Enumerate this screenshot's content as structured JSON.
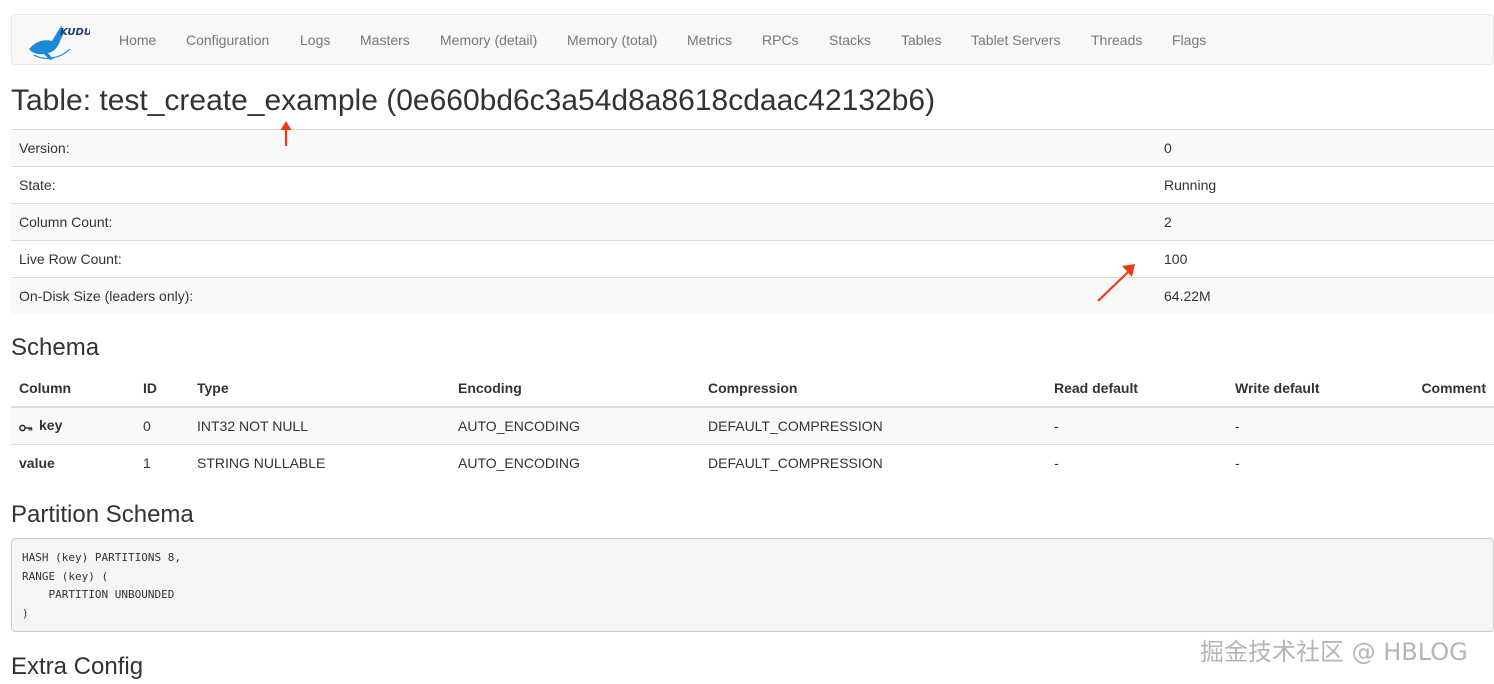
{
  "nav": {
    "brand_text": "KUDU",
    "items": [
      "Home",
      "Configuration",
      "Logs",
      "Masters",
      "Memory (detail)",
      "Memory (total)",
      "Metrics",
      "RPCs",
      "Stacks",
      "Tables",
      "Tablet Servers",
      "Threads",
      "Flags"
    ]
  },
  "page_title": "Table: test_create_example (0e660bd6c3a54d8a8618cdaac42132b6)",
  "summary": [
    {
      "label": "Version:",
      "value": "0"
    },
    {
      "label": "State:",
      "value": "Running"
    },
    {
      "label": "Column Count:",
      "value": "2"
    },
    {
      "label": "Live Row Count:",
      "value": "100"
    },
    {
      "label": "On-Disk Size (leaders only):",
      "value": "64.22M"
    }
  ],
  "schema": {
    "title": "Schema",
    "headers": [
      "Column",
      "ID",
      "Type",
      "Encoding",
      "Compression",
      "Read default",
      "Write default",
      "Comment"
    ],
    "rows": [
      {
        "column": "key",
        "id": "0",
        "type": "INT32 NOT NULL",
        "encoding": "AUTO_ENCODING",
        "compression": "DEFAULT_COMPRESSION",
        "read_default": "-",
        "write_default": "-",
        "comment": ""
      },
      {
        "column": "value",
        "id": "1",
        "type": "STRING NULLABLE",
        "encoding": "AUTO_ENCODING",
        "compression": "DEFAULT_COMPRESSION",
        "read_default": "-",
        "write_default": "-",
        "comment": ""
      }
    ]
  },
  "partition": {
    "title": "Partition Schema",
    "code": "HASH (key) PARTITIONS 8,\nRANGE (key) (\n    PARTITION UNBOUNDED\n)"
  },
  "extra_config_title": "Extra Config",
  "watermark": "掘金技术社区 @ HBLOG",
  "colors": {
    "navbar_bg": "#f8f8f8",
    "nav_text": "#777777",
    "annotation_arrow": "#f03a17",
    "logo_blue": "#1e88d8"
  }
}
